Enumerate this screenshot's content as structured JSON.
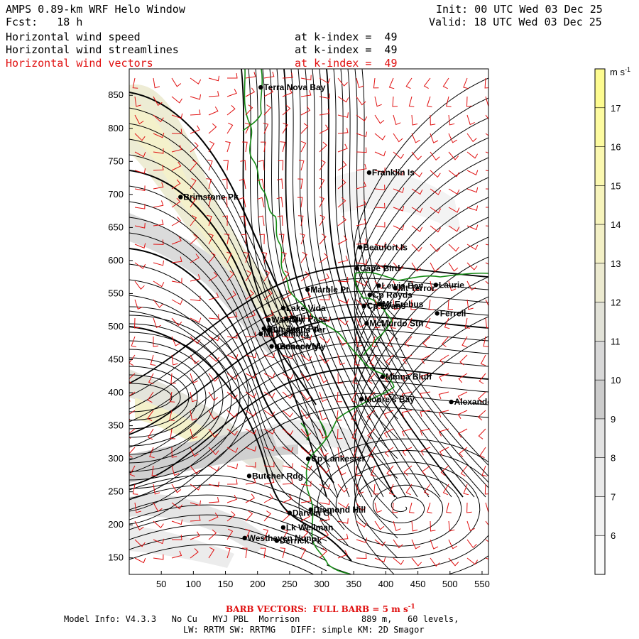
{
  "header": {
    "title": "AMPS 0.89-km WRF Helo Window",
    "fcst": "Fcst:   18 h",
    "init": "Init: 00 UTC Wed 03 Dec 25",
    "valid": "Valid: 18 UTC Wed 03 Dec 25",
    "fields": [
      {
        "name": "Horizontal wind speed",
        "level": "at k-index =  49",
        "color": "#000000"
      },
      {
        "name": "Horizontal wind streamlines",
        "level": "at k-index =  49",
        "color": "#000000"
      },
      {
        "name": "Horizontal wind vectors",
        "level": "at k-index =  49",
        "color": "#e01010"
      }
    ]
  },
  "axes": {
    "x_ticks": [
      "50",
      "100",
      "150",
      "200",
      "250",
      "300",
      "350",
      "400",
      "450",
      "500",
      "550"
    ],
    "y_ticks": [
      "850",
      "800",
      "750",
      "700",
      "650",
      "600",
      "550",
      "500",
      "450",
      "400",
      "350",
      "300",
      "250",
      "200",
      "150"
    ],
    "x_range": [
      0,
      560
    ],
    "y_range": [
      125,
      890
    ]
  },
  "colorbar": {
    "unit": "m s",
    "unit_exp": "-1",
    "labels": [
      "17",
      "16",
      "15",
      "14",
      "13",
      "12",
      "11",
      "10",
      "9",
      "8",
      "7",
      "6"
    ],
    "colors": [
      "#fdfba0",
      "#fbf8b0",
      "#f7f4bc",
      "#f3f0c6",
      "#ecead0",
      "#e2e2d8",
      "#d8d8d8",
      "#cccccc",
      "#e2e2e2",
      "#eaeaea",
      "#f2f2f2",
      "#fafafa"
    ]
  },
  "places": [
    {
      "name": "Terra Nova Bay",
      "x": 205,
      "y": 862
    },
    {
      "name": "Franklin Is",
      "x": 374,
      "y": 733
    },
    {
      "name": "Brimstone Pk",
      "x": 80,
      "y": 696
    },
    {
      "name": "Beaufort Is",
      "x": 360,
      "y": 620
    },
    {
      "name": "Cape Bird",
      "x": 355,
      "y": 588
    },
    {
      "name": "Marble Pt",
      "x": 278,
      "y": 556
    },
    {
      "name": "Lewis Bay",
      "x": 389,
      "y": 562
    },
    {
      "name": "Mt Terror",
      "x": 415,
      "y": 558
    },
    {
      "name": "Laurie",
      "x": 478,
      "y": 563
    },
    {
      "name": "Cp Royds",
      "x": 375,
      "y": 548
    },
    {
      "name": "Mt Erebus",
      "x": 390,
      "y": 534
    },
    {
      "name": "Lake Vida",
      "x": 240,
      "y": 528
    },
    {
      "name": "Cp Evans",
      "x": 366,
      "y": 531
    },
    {
      "name": "Wall Vly",
      "x": 217,
      "y": 510
    },
    {
      "name": "Bull Pass",
      "x": 245,
      "y": 512
    },
    {
      "name": "McMurdo Stn",
      "x": 370,
      "y": 505
    },
    {
      "name": "Ferrell",
      "x": 480,
      "y": 520
    },
    {
      "name": "Don Juan Pd",
      "x": 210,
      "y": 497
    },
    {
      "name": "Linnaeus Ter",
      "x": 220,
      "y": 495
    },
    {
      "name": "Mt Fleming",
      "x": 205,
      "y": 489
    },
    {
      "name": "Kennar Vly",
      "x": 222,
      "y": 470
    },
    {
      "name": "Beacon Vly",
      "x": 230,
      "y": 470
    },
    {
      "name": "Minna Bluff",
      "x": 395,
      "y": 424
    },
    {
      "name": "Moore's Bay",
      "x": 362,
      "y": 390
    },
    {
      "name": "Alexander",
      "x": 502,
      "y": 386
    },
    {
      "name": "Cp Lankester",
      "x": 279,
      "y": 300
    },
    {
      "name": "Butcher Rdg",
      "x": 187,
      "y": 274
    },
    {
      "name": "Darwin Gl",
      "x": 250,
      "y": 218
    },
    {
      "name": "Diamond Hill",
      "x": 283,
      "y": 223
    },
    {
      "name": "Lk Wellman",
      "x": 240,
      "y": 196
    },
    {
      "name": "Westhaven Nun",
      "x": 180,
      "y": 180
    },
    {
      "name": "Derrick Pk",
      "x": 230,
      "y": 176
    }
  ],
  "footer": {
    "barb_note": "BARB VECTORS:  FULL BARB = 5 m s",
    "barb_note_exp": "-1",
    "line1": "Model Info: V4.3.3   No Cu   MYJ PBL  Morrison            889 m,   60 levels,",
    "line2": "LW: RRTM SW: RRTMG   DIFF: simple KM: 2D Smagor"
  }
}
